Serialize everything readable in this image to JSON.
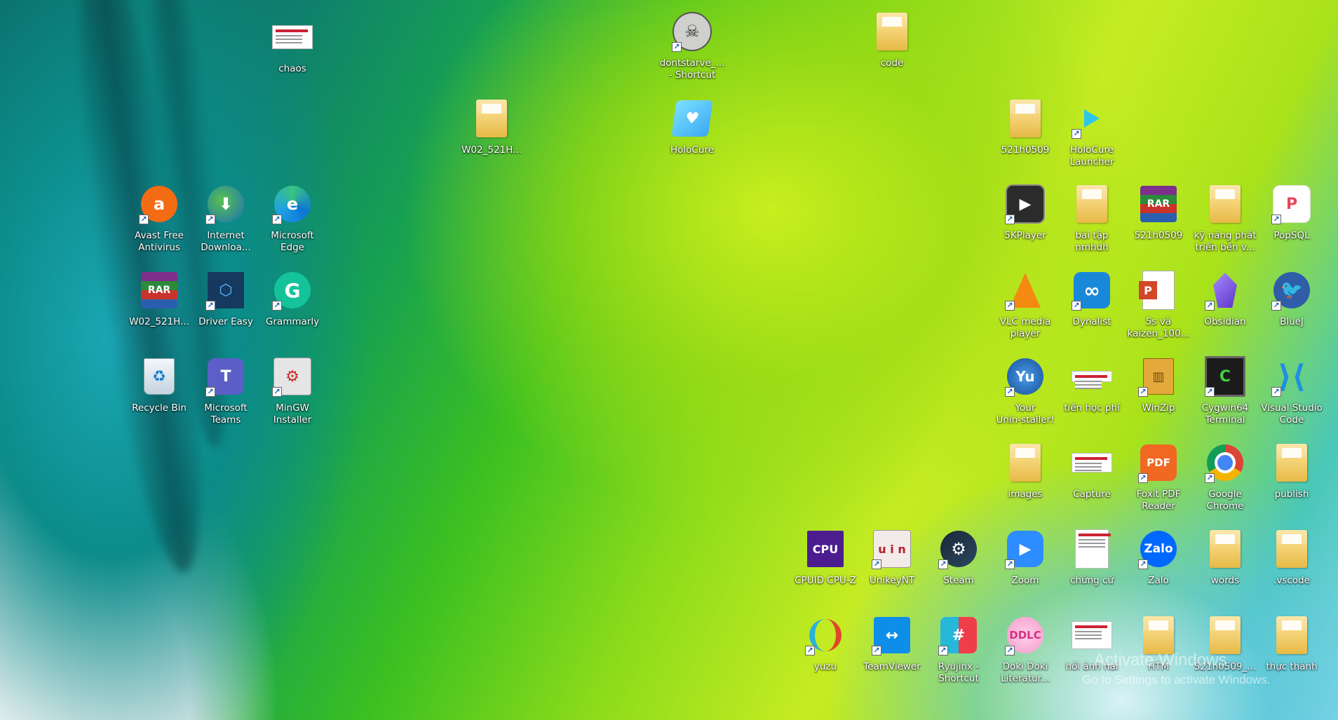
{
  "desktop": {
    "icons": [
      {
        "label": "chaos",
        "icon": "document-thumbnail-icon"
      },
      {
        "label": "dontstarve_...\n- Shortcut",
        "icon": "dont-starve-icon"
      },
      {
        "label": "code",
        "icon": "folder-icon"
      },
      {
        "label": "W02_521H...",
        "icon": "folder-icon"
      },
      {
        "label": "HoloCure",
        "icon": "holocure-icon"
      },
      {
        "label": "521h0509",
        "icon": "folder-icon"
      },
      {
        "label": "HoloCure\nLauncher",
        "icon": "holocure-launcher-icon"
      },
      {
        "label": "Avast Free\nAntivirus",
        "icon": "avast-icon"
      },
      {
        "label": "Internet\nDownloa...",
        "icon": "internet-download-manager-icon"
      },
      {
        "label": "Microsoft\nEdge",
        "icon": "edge-icon"
      },
      {
        "label": "5KPlayer",
        "icon": "5kplayer-icon"
      },
      {
        "label": "bài tập\nnmhdh",
        "icon": "folder-icon"
      },
      {
        "label": "521h0509",
        "icon": "winrar-icon"
      },
      {
        "label": "kỹ năng phát\ntriển bền v...",
        "icon": "folder-icon"
      },
      {
        "label": "PopSQL",
        "icon": "popsql-icon"
      },
      {
        "label": "W02_521H...",
        "icon": "winrar-icon"
      },
      {
        "label": "Driver Easy",
        "icon": "driver-easy-icon"
      },
      {
        "label": "Grammarly",
        "icon": "grammarly-icon"
      },
      {
        "label": "VLC media\nplayer",
        "icon": "vlc-icon"
      },
      {
        "label": "Dynalist",
        "icon": "dynalist-icon"
      },
      {
        "label": "5s và\nkaizen_100...",
        "icon": "powerpoint-icon"
      },
      {
        "label": "Obsidian",
        "icon": "obsidian-icon"
      },
      {
        "label": "BlueJ",
        "icon": "bluej-icon"
      },
      {
        "label": "Recycle Bin",
        "icon": "recycle-bin-icon"
      },
      {
        "label": "Microsoft\nTeams",
        "icon": "teams-icon"
      },
      {
        "label": "MinGW\nInstaller",
        "icon": "mingw-icon"
      },
      {
        "label": "Your\nUnin-staller!",
        "icon": "your-uninstaller-icon"
      },
      {
        "label": "tiền học phí",
        "icon": "document-thumbnail-icon"
      },
      {
        "label": "WinZip",
        "icon": "winzip-icon"
      },
      {
        "label": "Cygwin64\nTerminal",
        "icon": "cygwin-icon"
      },
      {
        "label": "Visual Studio\nCode",
        "icon": "vscode-icon"
      },
      {
        "label": "images",
        "icon": "folder-icon"
      },
      {
        "label": "Capture",
        "icon": "document-thumbnail-icon"
      },
      {
        "label": "Foxit PDF\nReader",
        "icon": "foxit-pdf-icon"
      },
      {
        "label": "Google\nChrome",
        "icon": "chrome-icon"
      },
      {
        "label": "publish",
        "icon": "folder-icon"
      },
      {
        "label": "CPUID CPU-Z",
        "icon": "cpuz-icon"
      },
      {
        "label": "UnikeyNT",
        "icon": "unikey-icon"
      },
      {
        "label": "Steam",
        "icon": "steam-icon"
      },
      {
        "label": "Zoom",
        "icon": "zoom-icon"
      },
      {
        "label": "chứng cứ",
        "icon": "document-thumbnail-icon"
      },
      {
        "label": "Zalo",
        "icon": "zalo-icon"
      },
      {
        "label": "words",
        "icon": "folder-icon"
      },
      {
        "label": ".vscode",
        "icon": "folder-icon"
      },
      {
        "label": "yuzu",
        "icon": "yuzu-icon"
      },
      {
        "label": "TeamViewer",
        "icon": "teamviewer-icon"
      },
      {
        "label": "Ryujinx -\nShortcut",
        "icon": "ryujinx-icon"
      },
      {
        "label": "Doki Doki\nLiteratur...",
        "icon": "doki-doki-icon"
      },
      {
        "label": "hồi ảnh hai",
        "icon": "document-thumbnail-icon"
      },
      {
        "label": "HTM",
        "icon": "folder-icon"
      },
      {
        "label": "521h0509_...",
        "icon": "folder-icon"
      },
      {
        "label": "thực thành",
        "icon": "folder-icon"
      }
    ]
  },
  "watermark": {
    "title": "Activate Windows",
    "subtitle": "Go to Settings to activate Windows."
  }
}
